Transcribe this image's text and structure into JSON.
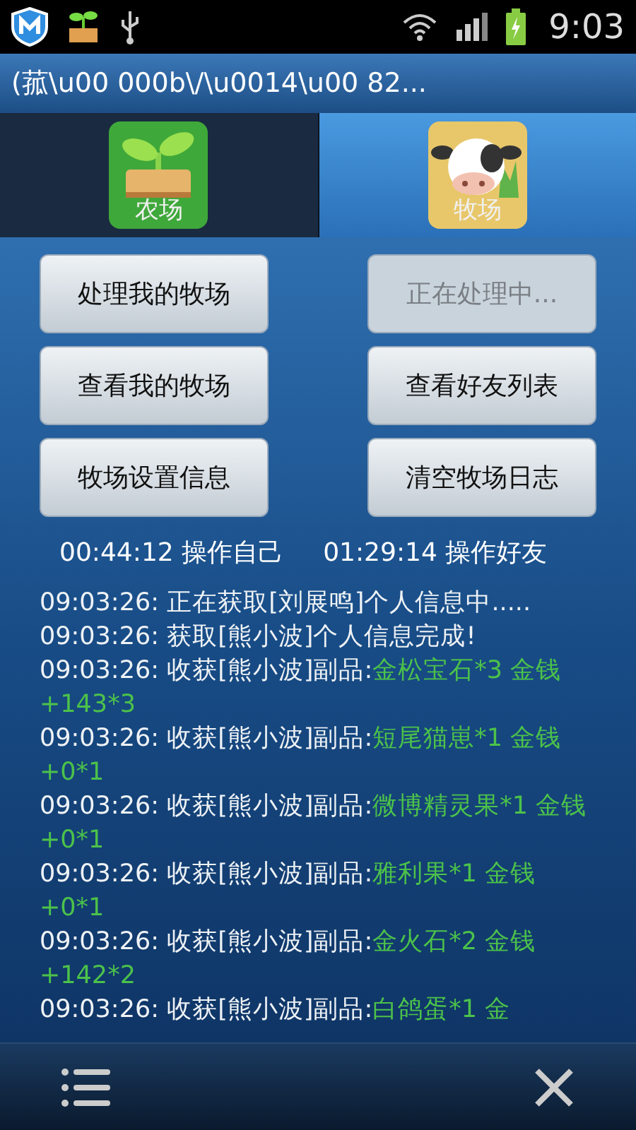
{
  "status_bar": {
    "time": "9:03",
    "charging": true
  },
  "window": {
    "title": "(菰\\u00 000b\\/\\u0014\\u00 82..."
  },
  "tabs": [
    {
      "label": "农场",
      "kind": "farm",
      "selected": false
    },
    {
      "label": "牧场",
      "kind": "ranch",
      "selected": true
    }
  ],
  "buttons": [
    {
      "label": "处理我的牧场",
      "disabled": false
    },
    {
      "label": "正在处理中...",
      "disabled": true
    },
    {
      "label": "查看我的牧场",
      "disabled": false
    },
    {
      "label": "查看好友列表",
      "disabled": false
    },
    {
      "label": "牧场设置信息",
      "disabled": false
    },
    {
      "label": "清空牧场日志",
      "disabled": false
    }
  ],
  "timers": [
    "00:44:12 操作自己",
    "01:29:14 操作好友"
  ],
  "log": [
    {
      "time": "09:03:26:",
      "text": "正在获取[刘展鸣]个人信息中....."
    },
    {
      "time": "09:03:26:",
      "text": "获取[熊小波]个人信息完成!"
    },
    {
      "time": "09:03:26:",
      "text": "收获[熊小波]副品:",
      "reward": "金松宝石*3 金钱+143*3"
    },
    {
      "time": "09:03:26:",
      "text": "收获[熊小波]副品:",
      "reward": "短尾猫崽*1 金钱+0*1"
    },
    {
      "time": "09:03:26:",
      "text": "收获[熊小波]副品:",
      "reward": "微博精灵果*1 金钱+0*1"
    },
    {
      "time": "09:03:26:",
      "text": "收获[熊小波]副品:",
      "reward": "雅利果*1 金钱+0*1"
    },
    {
      "time": "09:03:26:",
      "text": "收获[熊小波]副品:",
      "reward": "金火石*2 金钱+142*2"
    },
    {
      "time": "09:03:26:",
      "text": "收获[熊小波]副品:",
      "reward": "白鸽蛋*1 金"
    }
  ]
}
